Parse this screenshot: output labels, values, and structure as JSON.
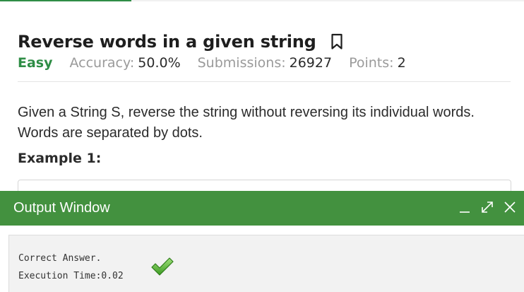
{
  "progress": {
    "fraction": 0.25,
    "color": "#2f8d46"
  },
  "problem": {
    "title": "Reverse words in a given string",
    "difficulty": "Easy",
    "accuracy_label": "Accuracy:",
    "accuracy_value": "50.0%",
    "submissions_label": "Submissions:",
    "submissions_value": "26927",
    "points_label": "Points:",
    "points_value": "2",
    "description": "Given a String S, reverse the string without reversing its individual words. Words are separated by dots.",
    "example_heading": "Example 1:"
  },
  "output_window": {
    "title": "Output Window",
    "header_color": "#43913f",
    "controls": [
      "minimize-icon",
      "expand-icon",
      "close-icon"
    ],
    "result_text": "Correct Answer.",
    "result_icon": "checkmark-icon",
    "execution_time": "Execution Time:0.02"
  }
}
